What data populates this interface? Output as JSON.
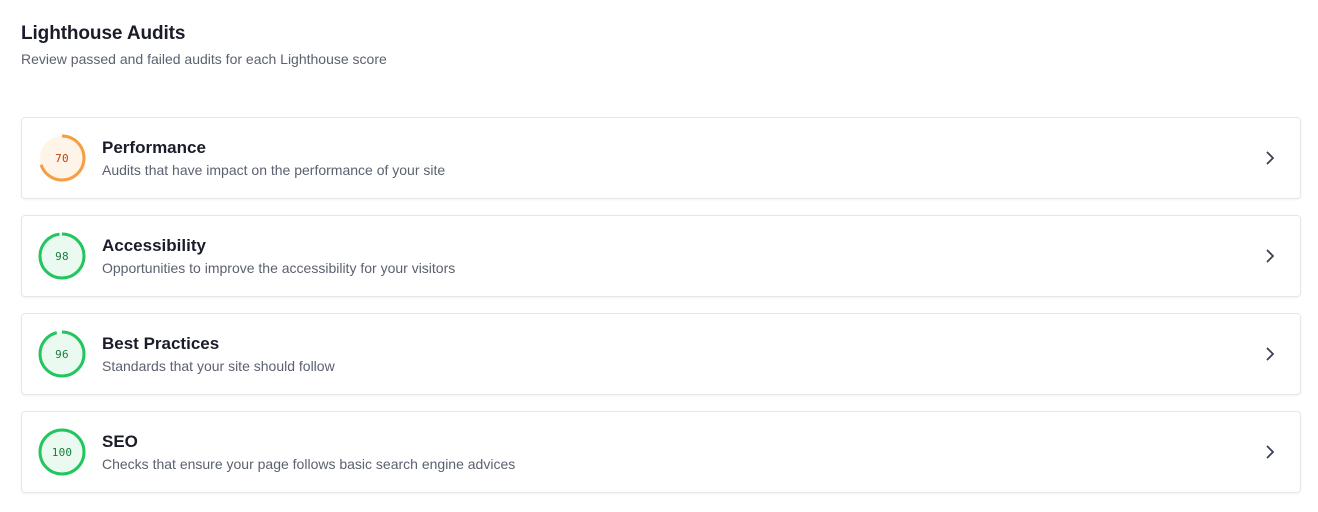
{
  "header": {
    "title": "Lighthouse Audits",
    "subtitle": "Review passed and failed audits for each Lighthouse score"
  },
  "colors": {
    "pass_stroke": "#22c55e",
    "pass_fill": "#eafaf0",
    "pass_text": "#15803d",
    "average_stroke": "#f59e42",
    "average_fill": "#fef4e8",
    "average_text": "#c2410c",
    "track": "#e8e8e8"
  },
  "audits": [
    {
      "score": 70,
      "score_label": "70",
      "status": "average",
      "title": "Performance",
      "description": "Audits that have impact on the performance of your site",
      "icon": "chevron-right-icon"
    },
    {
      "score": 98,
      "score_label": "98",
      "status": "pass",
      "title": "Accessibility",
      "description": "Opportunities to improve the accessibility for your visitors",
      "icon": "chevron-right-icon"
    },
    {
      "score": 96,
      "score_label": "96",
      "status": "pass",
      "title": "Best Practices",
      "description": "Standards that your site should follow",
      "icon": "chevron-right-icon"
    },
    {
      "score": 100,
      "score_label": "100",
      "status": "pass",
      "title": "SEO",
      "description": "Checks that ensure your page follows basic search engine advices",
      "icon": "chevron-right-icon"
    }
  ]
}
